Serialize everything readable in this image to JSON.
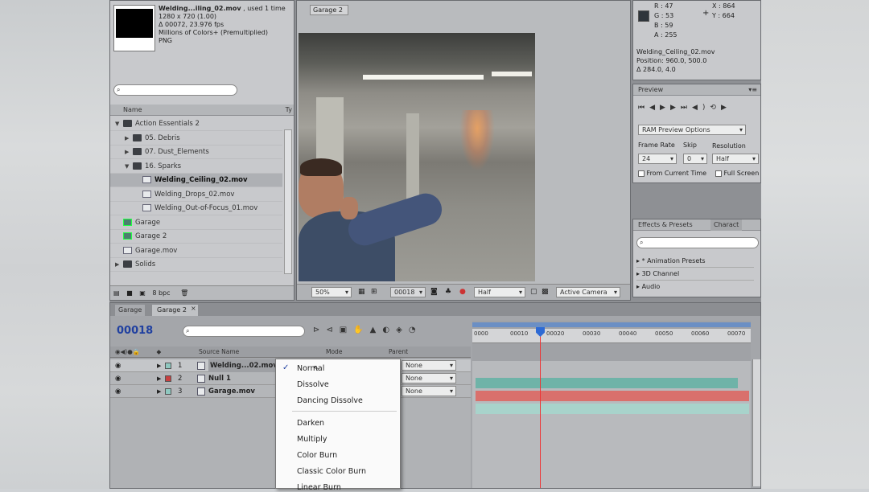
{
  "project": {
    "footage_name": "Welding...iling_02.mov",
    "used_count": ", used 1 time",
    "resolution": "1280 x 720 (1.00)",
    "duration": "Δ 00072, 23.976 fps",
    "colors": "Millions of Colors+ (Premultiplied)",
    "codec": "PNG",
    "col_name": "Name",
    "col_type": "Ty",
    "bpc": "8 bpc",
    "items": [
      {
        "label": "Action Essentials 2",
        "kind": "folder",
        "indent": 0,
        "twirl": "▼"
      },
      {
        "label": "05. Debris",
        "kind": "folder",
        "indent": 1,
        "twirl": "▶"
      },
      {
        "label": "07. Dust_Elements",
        "kind": "folder",
        "indent": 1,
        "twirl": "▶"
      },
      {
        "label": "16. Sparks",
        "kind": "folder",
        "indent": 1,
        "twirl": "▼"
      },
      {
        "label": "Welding_Ceiling_02.mov",
        "kind": "file",
        "indent": 2,
        "twirl": ""
      },
      {
        "label": "Welding_Drops_02.mov",
        "kind": "file",
        "indent": 2,
        "twirl": ""
      },
      {
        "label": "Welding_Out-of-Focus_01.mov",
        "kind": "file",
        "indent": 2,
        "twirl": ""
      },
      {
        "label": "Garage",
        "kind": "comp",
        "indent": 0,
        "twirl": ""
      },
      {
        "label": "Garage 2",
        "kind": "comp",
        "indent": 0,
        "twirl": ""
      },
      {
        "label": "Garage.mov",
        "kind": "file",
        "indent": 0,
        "twirl": ""
      },
      {
        "label": "Solids",
        "kind": "folder",
        "indent": 0,
        "twirl": "▶"
      }
    ]
  },
  "viewer": {
    "tab": "Garage 2",
    "zoom": "50%",
    "timecode": "00018",
    "resolution": "Half",
    "camera": "Active Camera"
  },
  "info": {
    "r": "R : 47",
    "g": "G : 53",
    "b": "B : 59",
    "a": "A : 255",
    "x": "X : 864",
    "y": "Y : 664",
    "layer_name": "Welding_Ceiling_02.mov",
    "position": "Position: 960.0, 500.0",
    "delta": "Δ 284.0, 4.0"
  },
  "preview": {
    "title": "Preview",
    "ram_options": "RAM Preview Options",
    "frame_rate_label": "Frame Rate",
    "skip_label": "Skip",
    "resolution_label": "Resolution",
    "frame_rate": "24",
    "skip": "0",
    "resolution": "Half",
    "from_current": "From Current Time",
    "full_screen": "Full Screen"
  },
  "effects": {
    "tab1": "Effects & Presets",
    "tab2": "Charact",
    "items": [
      "* Animation Presets",
      "3D Channel",
      "Audio"
    ]
  },
  "timeline": {
    "tab1": "Garage",
    "tab2": "Garage 2",
    "timecode": "00018",
    "col_source": "Source Name",
    "col_mode": "Mode",
    "col_parent": "Parent",
    "ruler": [
      "0000",
      "00010",
      "00020",
      "00030",
      "00040",
      "00050",
      "00060",
      "00070"
    ],
    "layers": [
      {
        "num": "1",
        "name": "Welding...02.mov",
        "parent": "None",
        "color": "#8fc8c0",
        "bar": "#6fb3a8"
      },
      {
        "num": "2",
        "name": "Null 1",
        "parent": "None",
        "color": "#c84040",
        "bar": "#d9706c"
      },
      {
        "num": "3",
        "name": "Garage.mov",
        "parent": "None",
        "color": "#8fc8c0",
        "bar": "#a8d3cb"
      }
    ]
  },
  "mode_menu": {
    "checked": "✓",
    "items": [
      "Normal",
      "Dissolve",
      "Dancing Dissolve",
      "Darken",
      "Multiply",
      "Color Burn",
      "Classic Color Burn",
      "Linear Burn"
    ]
  }
}
